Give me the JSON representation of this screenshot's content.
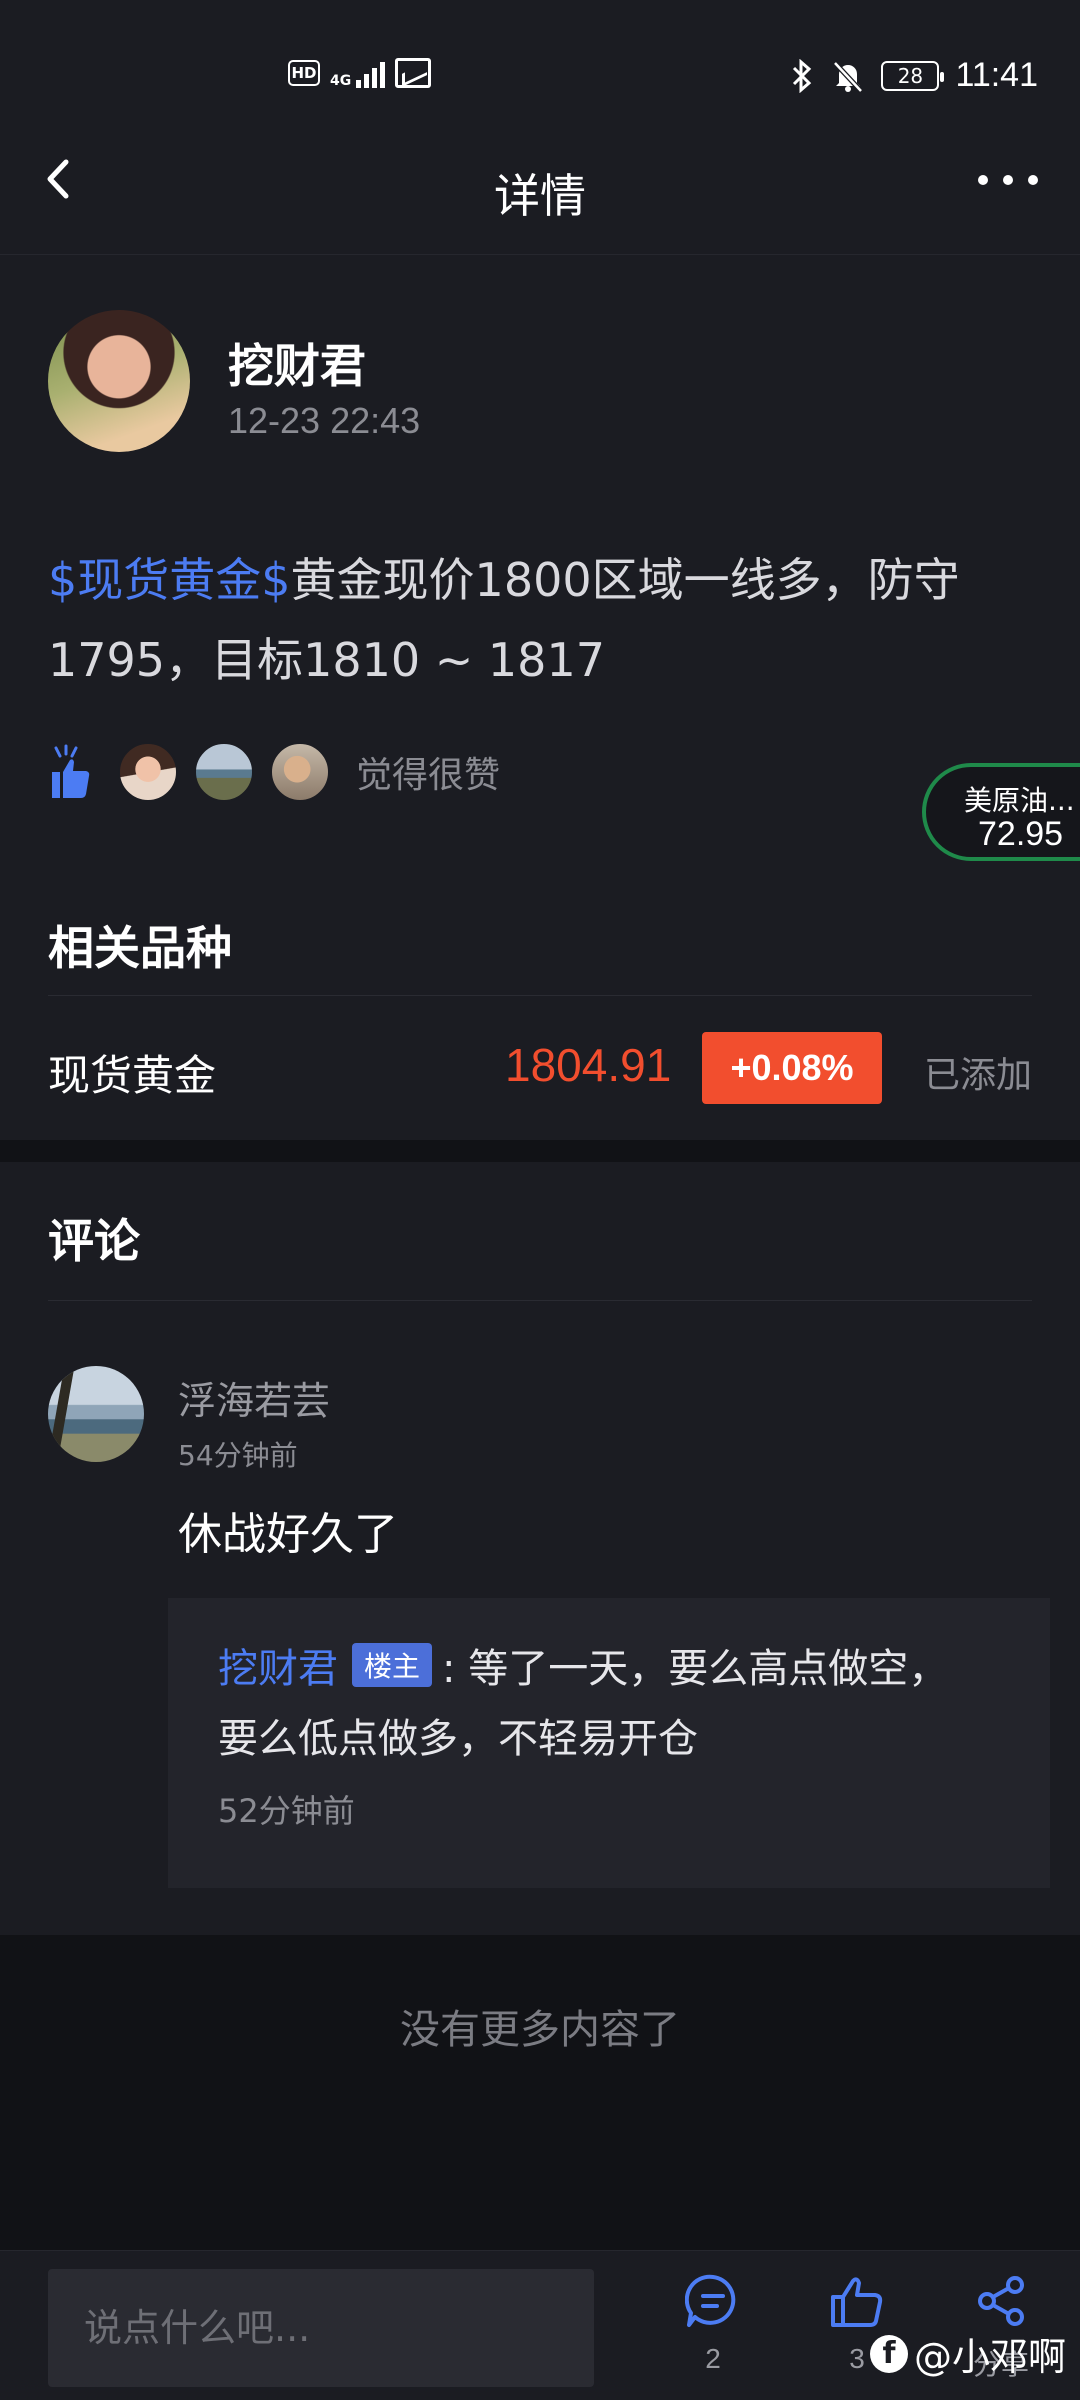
{
  "status_bar": {
    "hd": "HD",
    "network": "4G",
    "battery": "28",
    "time": "11:41"
  },
  "header": {
    "title": "详情"
  },
  "post": {
    "author": "挖财君",
    "time": "12-23 22:43",
    "tag": "$现货黄金$",
    "text_line1": "黄金现价1800区域一线多，防守",
    "text_line2": "1795，目标1810 ~ 1817",
    "like_text": "觉得很赞"
  },
  "floating_widget": {
    "name": "美原油...",
    "value": "72.95"
  },
  "related": {
    "title": "相关品种",
    "items": [
      {
        "name": "现货黄金",
        "price": "1804.91",
        "change": "+0.08%",
        "status": "已添加"
      }
    ]
  },
  "comments": {
    "title": "评论",
    "items": [
      {
        "user": "浮海若芸",
        "time": "54分钟前",
        "text": "休战好久了",
        "reply": {
          "author": "挖财君",
          "badge": "楼主",
          "text_line1": ": 等了一天，要么高点做空，",
          "text_line2": "要么低点做多，不轻易开仓",
          "time": "52分钟前"
        }
      }
    ],
    "no_more": "没有更多内容了"
  },
  "bottom_bar": {
    "input_placeholder": "说点什么吧...",
    "comment_count": "2",
    "like_count": "3",
    "share_label": "分享"
  },
  "watermark": {
    "text": "@小邓啊"
  },
  "colors": {
    "background": "#1b1c22",
    "link_blue": "#4c7cf3",
    "price_red": "#f24e2e",
    "widget_green": "#1f8a4a"
  }
}
